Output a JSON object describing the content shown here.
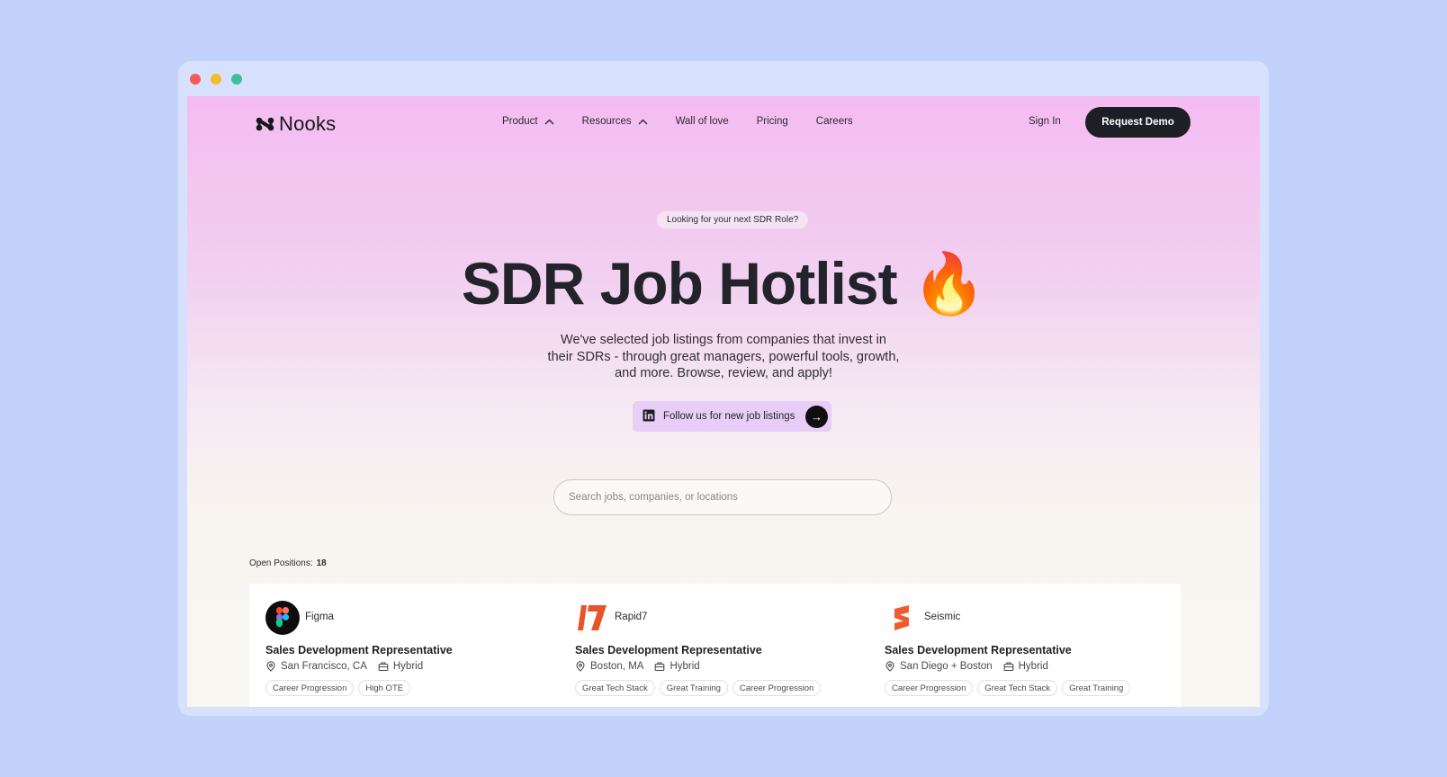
{
  "brand": {
    "name": "Nooks"
  },
  "nav": {
    "items": [
      {
        "label": "Product",
        "has_chevron": true
      },
      {
        "label": "Resources",
        "has_chevron": true
      },
      {
        "label": "Wall of love",
        "has_chevron": false
      },
      {
        "label": "Pricing",
        "has_chevron": false
      },
      {
        "label": "Careers",
        "has_chevron": false
      }
    ],
    "sign_in": "Sign In",
    "cta": "Request Demo"
  },
  "hero": {
    "eyebrow": "Looking for your next SDR Role?",
    "title": "SDR Job Hotlist",
    "title_emoji": "🔥",
    "subtitle": "We've selected job listings from companies that invest in their SDRs - through great managers, powerful tools, growth, and more. Browse, review, and apply!",
    "follow_label": "Follow us for new job listings",
    "follow_icon": "linkedin-icon",
    "arrow": "→"
  },
  "search": {
    "placeholder": "Search jobs, companies, or locations",
    "value": ""
  },
  "positions": {
    "label": "Open Positions:",
    "count": "18"
  },
  "jobs": [
    {
      "company": "Figma",
      "role": "Sales Development Representative",
      "location": "San Francisco, CA",
      "work_type": "Hybrid",
      "tags": [
        "Career Progression",
        "High OTE"
      ]
    },
    {
      "company": "Rapid7",
      "role": "Sales Development Representative",
      "location": "Boston, MA",
      "work_type": "Hybrid",
      "tags": [
        "Great Tech Stack",
        "Great Training",
        "Career Progression"
      ]
    },
    {
      "company": "Seismic",
      "role": "Sales Development Representative",
      "location": "San Diego + Boston",
      "work_type": "Hybrid",
      "tags": [
        "Career Progression",
        "Great Tech Stack",
        "Great Training"
      ]
    }
  ],
  "colors": {
    "page_bg": "#c3d2fb",
    "window_chrome": "#d7e1fd",
    "hero_top": "#f4bcf1",
    "cta_bg": "#1e1f26",
    "follow_bg": "#e8cdf6",
    "rapid7": "#e8542a",
    "seismic": "#ef5a2f"
  }
}
